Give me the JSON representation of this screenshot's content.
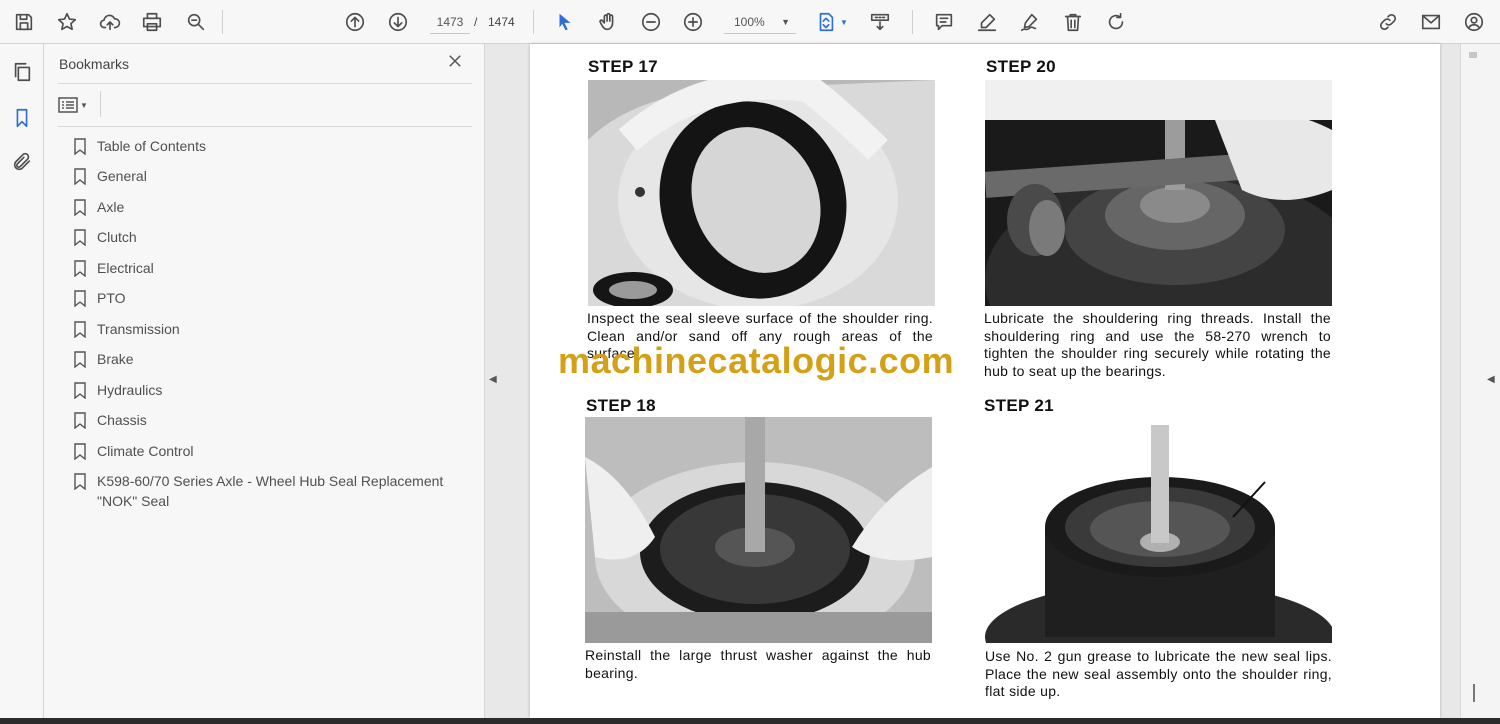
{
  "toolbar": {
    "page_current": "1473",
    "page_separator": "/",
    "page_total": "1474",
    "zoom_value": "100%",
    "icons": [
      "save-icon",
      "star-icon",
      "cloud-upload-icon",
      "print-icon",
      "zoom-search-icon",
      "page-up-icon",
      "page-down-icon",
      "select-cursor-icon",
      "hand-icon",
      "zoom-out-icon",
      "zoom-in-icon",
      "fit-page-icon",
      "scroll-mode-icon",
      "comment-icon",
      "highlight-icon",
      "sign-icon",
      "delete-icon",
      "rotate-icon",
      "share-link-icon",
      "mail-icon",
      "account-icon"
    ]
  },
  "bookmarks": {
    "title": "Bookmarks",
    "items": [
      {
        "label": "Table of Contents"
      },
      {
        "label": "General"
      },
      {
        "label": "Axle"
      },
      {
        "label": "Clutch"
      },
      {
        "label": "Electrical"
      },
      {
        "label": "PTO"
      },
      {
        "label": "Transmission"
      },
      {
        "label": "Brake"
      },
      {
        "label": "Hydraulics"
      },
      {
        "label": "Chassis"
      },
      {
        "label": "Climate Control"
      },
      {
        "label": "K598-60/70 Series Axle - Wheel Hub Seal Replacement \"NOK\" Seal"
      }
    ]
  },
  "document": {
    "steps": [
      {
        "title": "STEP 17",
        "caption": "Inspect the seal sleeve surface of the shoulder ring. Clean and/or sand off any rough areas of the surface."
      },
      {
        "title": "STEP 20",
        "caption": "Lubricate the shouldering ring threads. Install the shouldering ring and use the 58-270 wrench to tighten the shoulder ring securely while rotating the hub to seat up the bearings."
      },
      {
        "title": "STEP 18",
        "caption": "Reinstall the large thrust washer against the hub bearing."
      },
      {
        "title": "STEP 21",
        "caption": "Use No. 2 gun grease to lubricate the new seal lips. Place the new seal assembly onto the shoulder ring, flat side up."
      }
    ],
    "watermark": "machinecatalogic.com"
  },
  "colors": {
    "accent": "#2c6fd6",
    "watermark": "#d4a017",
    "panel_bg": "#f7f7f7"
  }
}
